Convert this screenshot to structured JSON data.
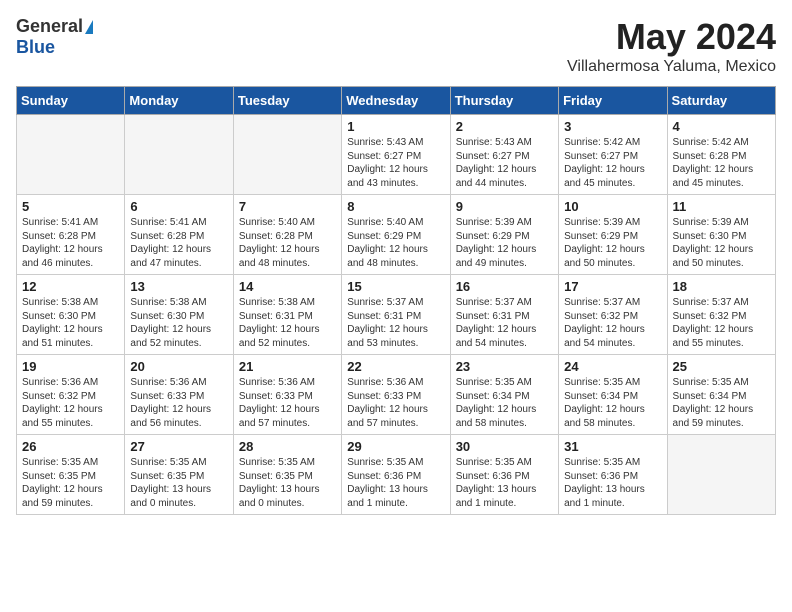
{
  "header": {
    "logo_general": "General",
    "logo_blue": "Blue",
    "title": "May 2024",
    "location": "Villahermosa Yaluma, Mexico"
  },
  "days_of_week": [
    "Sunday",
    "Monday",
    "Tuesday",
    "Wednesday",
    "Thursday",
    "Friday",
    "Saturday"
  ],
  "weeks": [
    [
      {
        "day": "",
        "empty": true
      },
      {
        "day": "",
        "empty": true
      },
      {
        "day": "",
        "empty": true
      },
      {
        "day": "1",
        "sunrise": "5:43 AM",
        "sunset": "6:27 PM",
        "daylight": "12 hours and 43 minutes."
      },
      {
        "day": "2",
        "sunrise": "5:43 AM",
        "sunset": "6:27 PM",
        "daylight": "12 hours and 44 minutes."
      },
      {
        "day": "3",
        "sunrise": "5:42 AM",
        "sunset": "6:27 PM",
        "daylight": "12 hours and 45 minutes."
      },
      {
        "day": "4",
        "sunrise": "5:42 AM",
        "sunset": "6:28 PM",
        "daylight": "12 hours and 45 minutes."
      }
    ],
    [
      {
        "day": "5",
        "sunrise": "5:41 AM",
        "sunset": "6:28 PM",
        "daylight": "12 hours and 46 minutes."
      },
      {
        "day": "6",
        "sunrise": "5:41 AM",
        "sunset": "6:28 PM",
        "daylight": "12 hours and 47 minutes."
      },
      {
        "day": "7",
        "sunrise": "5:40 AM",
        "sunset": "6:28 PM",
        "daylight": "12 hours and 48 minutes."
      },
      {
        "day": "8",
        "sunrise": "5:40 AM",
        "sunset": "6:29 PM",
        "daylight": "12 hours and 48 minutes."
      },
      {
        "day": "9",
        "sunrise": "5:39 AM",
        "sunset": "6:29 PM",
        "daylight": "12 hours and 49 minutes."
      },
      {
        "day": "10",
        "sunrise": "5:39 AM",
        "sunset": "6:29 PM",
        "daylight": "12 hours and 50 minutes."
      },
      {
        "day": "11",
        "sunrise": "5:39 AM",
        "sunset": "6:30 PM",
        "daylight": "12 hours and 50 minutes."
      }
    ],
    [
      {
        "day": "12",
        "sunrise": "5:38 AM",
        "sunset": "6:30 PM",
        "daylight": "12 hours and 51 minutes."
      },
      {
        "day": "13",
        "sunrise": "5:38 AM",
        "sunset": "6:30 PM",
        "daylight": "12 hours and 52 minutes."
      },
      {
        "day": "14",
        "sunrise": "5:38 AM",
        "sunset": "6:31 PM",
        "daylight": "12 hours and 52 minutes."
      },
      {
        "day": "15",
        "sunrise": "5:37 AM",
        "sunset": "6:31 PM",
        "daylight": "12 hours and 53 minutes."
      },
      {
        "day": "16",
        "sunrise": "5:37 AM",
        "sunset": "6:31 PM",
        "daylight": "12 hours and 54 minutes."
      },
      {
        "day": "17",
        "sunrise": "5:37 AM",
        "sunset": "6:32 PM",
        "daylight": "12 hours and 54 minutes."
      },
      {
        "day": "18",
        "sunrise": "5:37 AM",
        "sunset": "6:32 PM",
        "daylight": "12 hours and 55 minutes."
      }
    ],
    [
      {
        "day": "19",
        "sunrise": "5:36 AM",
        "sunset": "6:32 PM",
        "daylight": "12 hours and 55 minutes."
      },
      {
        "day": "20",
        "sunrise": "5:36 AM",
        "sunset": "6:33 PM",
        "daylight": "12 hours and 56 minutes."
      },
      {
        "day": "21",
        "sunrise": "5:36 AM",
        "sunset": "6:33 PM",
        "daylight": "12 hours and 57 minutes."
      },
      {
        "day": "22",
        "sunrise": "5:36 AM",
        "sunset": "6:33 PM",
        "daylight": "12 hours and 57 minutes."
      },
      {
        "day": "23",
        "sunrise": "5:35 AM",
        "sunset": "6:34 PM",
        "daylight": "12 hours and 58 minutes."
      },
      {
        "day": "24",
        "sunrise": "5:35 AM",
        "sunset": "6:34 PM",
        "daylight": "12 hours and 58 minutes."
      },
      {
        "day": "25",
        "sunrise": "5:35 AM",
        "sunset": "6:34 PM",
        "daylight": "12 hours and 59 minutes."
      }
    ],
    [
      {
        "day": "26",
        "sunrise": "5:35 AM",
        "sunset": "6:35 PM",
        "daylight": "12 hours and 59 minutes."
      },
      {
        "day": "27",
        "sunrise": "5:35 AM",
        "sunset": "6:35 PM",
        "daylight": "13 hours and 0 minutes."
      },
      {
        "day": "28",
        "sunrise": "5:35 AM",
        "sunset": "6:35 PM",
        "daylight": "13 hours and 0 minutes."
      },
      {
        "day": "29",
        "sunrise": "5:35 AM",
        "sunset": "6:36 PM",
        "daylight": "13 hours and 1 minute."
      },
      {
        "day": "30",
        "sunrise": "5:35 AM",
        "sunset": "6:36 PM",
        "daylight": "13 hours and 1 minute."
      },
      {
        "day": "31",
        "sunrise": "5:35 AM",
        "sunset": "6:36 PM",
        "daylight": "13 hours and 1 minute."
      },
      {
        "day": "",
        "empty": true
      }
    ]
  ]
}
